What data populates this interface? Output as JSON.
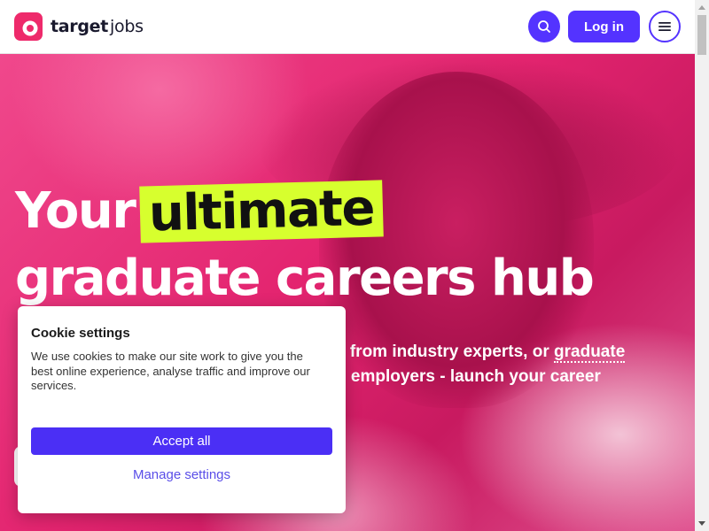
{
  "brand": {
    "name_bold": "target",
    "name_light": "jobs",
    "color": "#ee2a6b"
  },
  "header": {
    "login_label": "Log in",
    "search_icon": "search-icon",
    "menu_icon": "hamburger-menu-icon",
    "accent": "#5433ff"
  },
  "hero": {
    "title_word1": "Your",
    "title_highlight": "ultimate",
    "title_line2": "graduate careers hub",
    "subtitle_visible_part1": "e from industry experts, or",
    "subtitle_link2": "graduate",
    "subtitle_visible_part2": "g employers - launch your career",
    "highlight_color": "#d7ff2e",
    "background_color": "#e3246f"
  },
  "cookie": {
    "title": "Cookie settings",
    "text": "We use cookies to make our site work to give you the best online experience, analyse traffic and improve our services.",
    "accept_label": "Accept all",
    "manage_label": "Manage settings"
  }
}
